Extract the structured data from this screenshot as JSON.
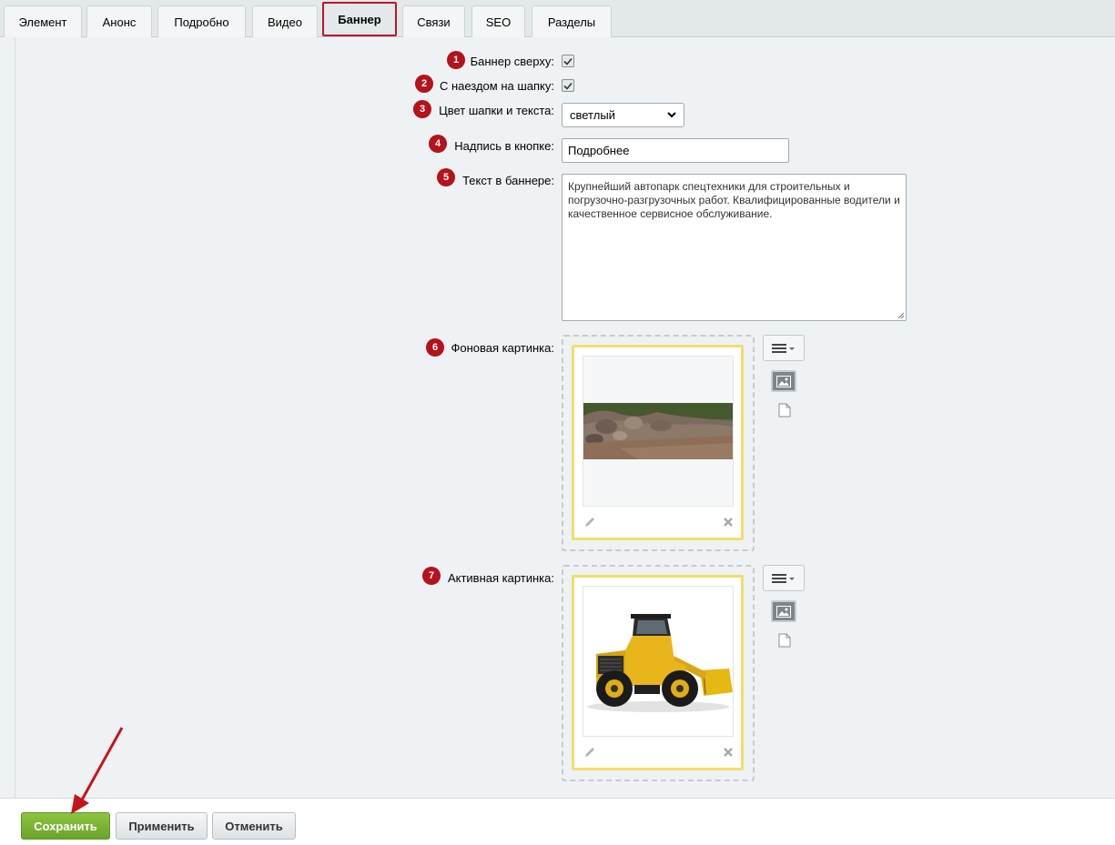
{
  "tabs": [
    {
      "label": "Элемент"
    },
    {
      "label": "Анонс"
    },
    {
      "label": "Подробно"
    },
    {
      "label": "Видео"
    },
    {
      "label": "Баннер"
    },
    {
      "label": "Связи"
    },
    {
      "label": "SEO"
    },
    {
      "label": "Разделы"
    }
  ],
  "active_tab": "Баннер",
  "form": {
    "banner_top": {
      "num": "1",
      "label": "Баннер сверху:",
      "checked": true
    },
    "header_overlap": {
      "num": "2",
      "label": "С наездом на шапку:",
      "checked": true
    },
    "header_color": {
      "num": "3",
      "label": "Цвет шапки и текста:",
      "value": "светлый"
    },
    "button_text": {
      "num": "4",
      "label": "Надпись в кнопке:",
      "value": "Подробнее"
    },
    "banner_text": {
      "num": "5",
      "label": "Текст в баннере:",
      "value": "Крупнейший автопарк спецтехники для строительных и погрузочно-разгрузочных работ. Квалифицированные водители и качественное сервисное обслуживание."
    },
    "bg_image": {
      "num": "6",
      "label": "Фоновая картинка:"
    },
    "active_image": {
      "num": "7",
      "label": "Активная картинка:"
    }
  },
  "footer": {
    "save_label": "Сохранить",
    "apply_label": "Применить",
    "cancel_label": "Отменить"
  },
  "colors": {
    "badge": "#b5121b",
    "active_tab_border": "#b8182a",
    "image_frame": "#f2de6b",
    "save_button": "#7ab534"
  }
}
